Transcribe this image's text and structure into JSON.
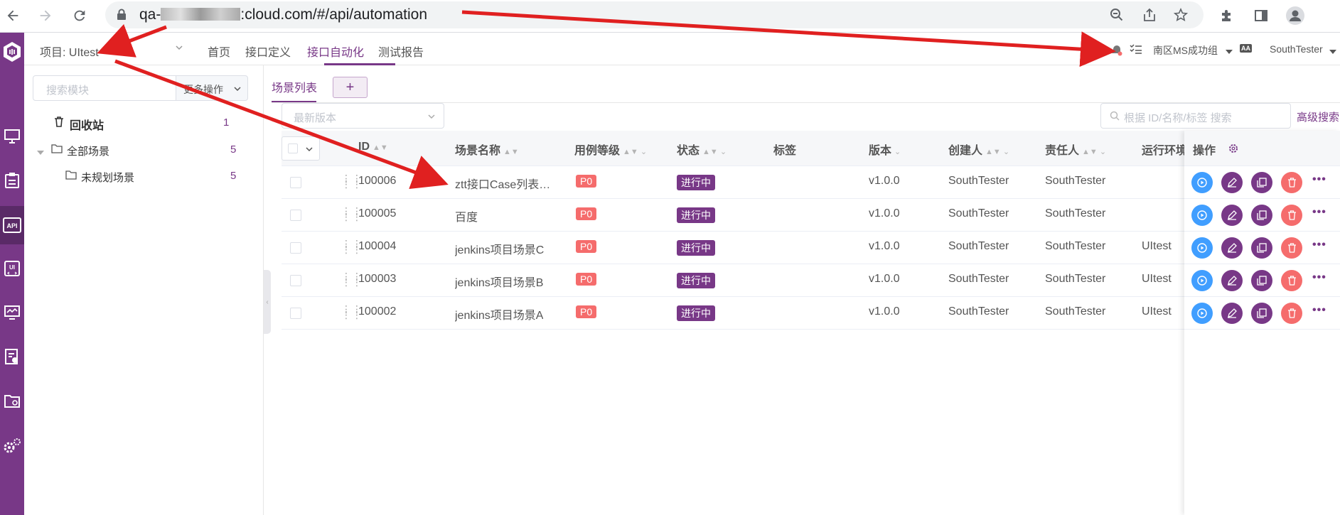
{
  "browser": {
    "url_prefix": "qa-",
    "url_suffix": ":cloud.com/#/api/automation"
  },
  "topbar": {
    "project_label": "项目: UItest",
    "menu": [
      "首页",
      "接口定义",
      "接口自动化",
      "测试报告"
    ],
    "active_menu": "接口自动化",
    "workspace": "南区MS成功组",
    "user": "SouthTester",
    "lang_icon": "AA"
  },
  "module_panel": {
    "search_placeholder": "搜索模块",
    "more_ops": "更多操作",
    "recycle_bin": {
      "label": "回收站",
      "count": "1"
    },
    "all_scenarios": {
      "label": "全部场景",
      "count": "5"
    },
    "unplanned": {
      "label": "未规划场景",
      "count": "5"
    }
  },
  "tabs": {
    "active": "场景列表",
    "add": "+"
  },
  "filters": {
    "version_placeholder": "最新版本",
    "search_placeholder": "根据 ID/名称/标签 搜索",
    "advanced_search": "高级搜索"
  },
  "table": {
    "columns": [
      "ID",
      "场景名称",
      "用例等级",
      "状态",
      "标签",
      "版本",
      "创建人",
      "责任人",
      "运行环境",
      "操作"
    ],
    "rows": [
      {
        "id": "100006",
        "name": "ztt接口Case列表…",
        "level": "P0",
        "status": "进行中",
        "tag": "",
        "version": "v1.0.0",
        "creator": "SouthTester",
        "owner": "SouthTester",
        "env": ""
      },
      {
        "id": "100005",
        "name": "百度",
        "level": "P0",
        "status": "进行中",
        "tag": "",
        "version": "v1.0.0",
        "creator": "SouthTester",
        "owner": "SouthTester",
        "env": ""
      },
      {
        "id": "100004",
        "name": "jenkins项目场景C",
        "level": "P0",
        "status": "进行中",
        "tag": "",
        "version": "v1.0.0",
        "creator": "SouthTester",
        "owner": "SouthTester",
        "env": "UItest"
      },
      {
        "id": "100003",
        "name": "jenkins项目场景B",
        "level": "P0",
        "status": "进行中",
        "tag": "",
        "version": "v1.0.0",
        "creator": "SouthTester",
        "owner": "SouthTester",
        "env": "UItest"
      },
      {
        "id": "100002",
        "name": "jenkins项目场景A",
        "level": "P0",
        "status": "进行中",
        "tag": "",
        "version": "v1.0.0",
        "creator": "SouthTester",
        "owner": "SouthTester",
        "env": "UItest"
      }
    ]
  },
  "colors": {
    "brand": "#783887",
    "run": "#409eff",
    "delete": "#f56c6c",
    "annotation": "#e02020"
  }
}
